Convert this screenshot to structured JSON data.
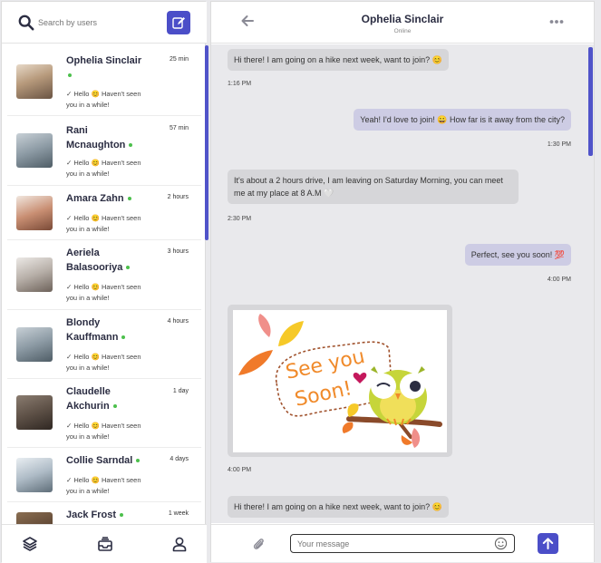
{
  "search": {
    "placeholder": "Search by users"
  },
  "contacts": [
    {
      "name": "Ophelia Sinclair",
      "time": "25 min",
      "preview": "✓ Hello 😊 Haven't seen you in a while!"
    },
    {
      "name": "Rani Mcnaughton",
      "time": "57 min",
      "preview": "✓ Hello 😊 Haven't seen you in a while!"
    },
    {
      "name": "Amara Zahn",
      "time": "2 hours",
      "preview": "✓ Hello 😊 Haven't seen you in a while!"
    },
    {
      "name": "Aeriela Balasooriya",
      "time": "3 hours",
      "preview": "✓ Hello 😊 Haven't seen you in a while!"
    },
    {
      "name": "Blondy Kauffmann",
      "time": "4 hours",
      "preview": "✓ Hello 😊 Haven't seen you in a while!"
    },
    {
      "name": "Claudelle Akchurin",
      "time": "1 day",
      "preview": "✓ Hello 😊 Haven't seen you in a while!"
    },
    {
      "name": "Collie Sarndal",
      "time": "4 days",
      "preview": "✓ Hello 😊 Haven't seen you in a while!"
    },
    {
      "name": "Jack Frost",
      "time": "1 week",
      "preview": ""
    }
  ],
  "chat": {
    "title": "Ophelia Sinclair",
    "status": "Online",
    "messages": [
      {
        "text": "Hi there! I am going on a hike next week, want to join? 😊",
        "time": "1:16 PM"
      },
      {
        "text": "Yeah! I'd love to join! 😀 How far is it away from the city?",
        "time": "1:30 PM"
      },
      {
        "text": "It's about a 2 hours drive, I am leaving on Saturday Morning, you can meet me at my place at 8 A.M 🤍",
        "time": "2:30 PM"
      },
      {
        "text": "Perfect, see you soon! 💯",
        "time": "4:00 PM"
      },
      {
        "sticker_text": "See you Soon!",
        "time": "4:00 PM"
      },
      {
        "text": "Hi there! I am going on a hike next week, want to join? 😊"
      }
    ]
  },
  "composer": {
    "placeholder": "Your message"
  },
  "colors": {
    "accent": "#4b4ec8",
    "online": "#4cc04c",
    "incoming": "#d6d6d9",
    "outgoing": "#cdcce4"
  },
  "icons": [
    "search-icon",
    "compose-icon",
    "layers-icon",
    "inbox-icon",
    "user-icon",
    "back-arrow-icon",
    "more-icon",
    "attach-icon",
    "emoji-icon",
    "send-icon"
  ]
}
